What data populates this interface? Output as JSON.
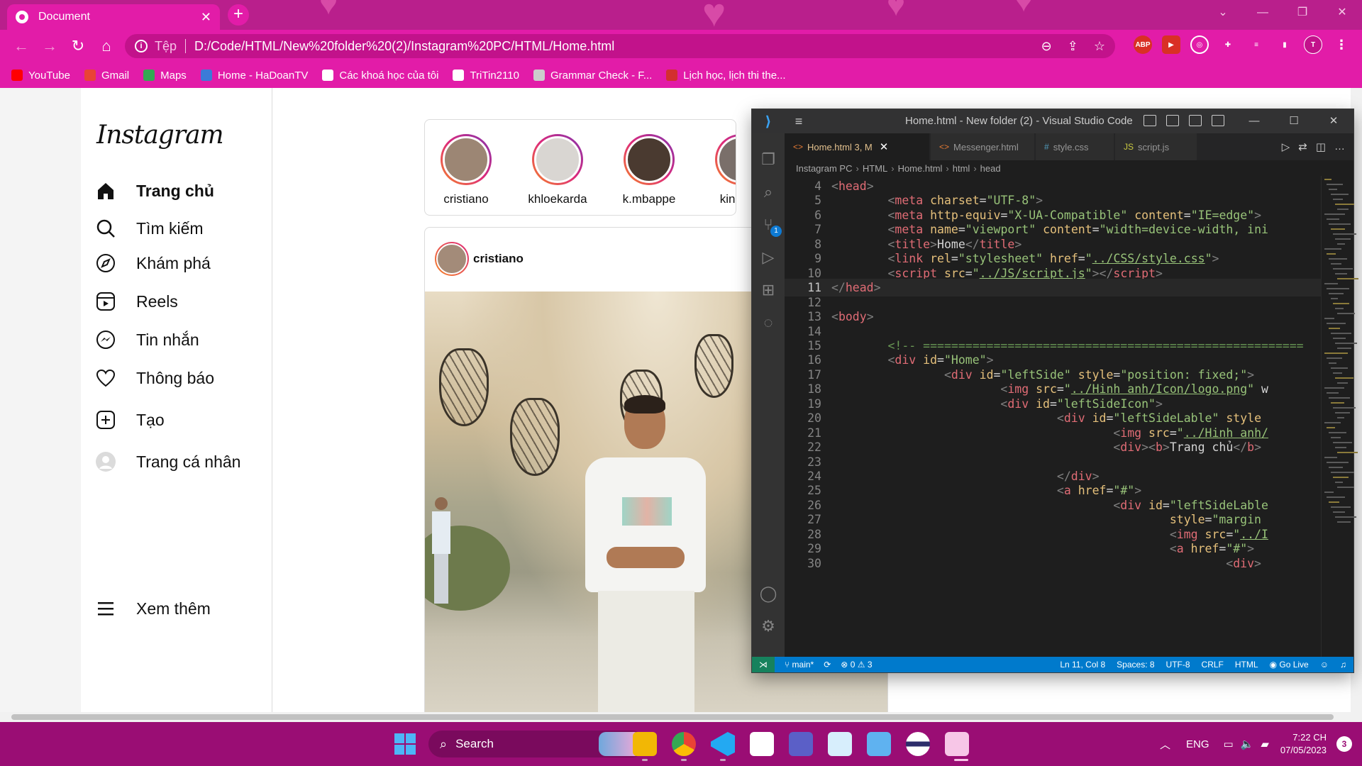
{
  "browser": {
    "tab_title": "Document",
    "tab_close": "✕",
    "new_tab": "+",
    "scheme_label": "Tệp",
    "url": "D:/Code/HTML/New%20folder%20(2)/Instagram%20PC/HTML/Home.html",
    "extensions": [
      "ABP",
      "▶",
      "◎",
      "✚",
      "≡",
      "▮",
      "T"
    ],
    "bookmarks": [
      {
        "label": "YouTube",
        "color": "#ff0000"
      },
      {
        "label": "Gmail",
        "color": "#ea4335"
      },
      {
        "label": "Maps",
        "color": "#34a853"
      },
      {
        "label": "Home - HaDoanTV",
        "color": "#3b7bd8"
      },
      {
        "label": "Các khoá học của tôi",
        "color": "#ffffff"
      },
      {
        "label": "TriTin2110",
        "color": "#ffffff"
      },
      {
        "label": "Grammar Check - F...",
        "color": "#cccccc"
      },
      {
        "label": "Lịch học, lịch thi the...",
        "color": "#d32f2f"
      }
    ]
  },
  "instagram": {
    "logo": "Instagram",
    "nav": [
      {
        "label": "Trang chủ",
        "icon": "home-icon",
        "bold": true
      },
      {
        "label": "Tìm kiếm",
        "icon": "search-icon"
      },
      {
        "label": "Khám phá",
        "icon": "compass-icon"
      },
      {
        "label": "Reels",
        "icon": "reels-icon"
      },
      {
        "label": "Tin nhắn",
        "icon": "messenger-icon"
      },
      {
        "label": "Thông báo",
        "icon": "heart-icon"
      },
      {
        "label": "Tạo",
        "icon": "create-icon"
      },
      {
        "label": "Trang cá nhân",
        "icon": "profile-icon"
      }
    ],
    "more": "Xem thêm",
    "stories": [
      {
        "name": "cristiano",
        "color": "#9c8674"
      },
      {
        "name": "khloekarda",
        "color": "#d9d6d2"
      },
      {
        "name": "k.mbappe",
        "color": "#4a3a30"
      },
      {
        "name": "kingjam",
        "color": "#7a6f6a"
      }
    ],
    "post": {
      "username": "cristiano"
    }
  },
  "vscode": {
    "title": "Home.html - New folder (2) - Visual Studio Code",
    "tabs": [
      {
        "label": "Home.html 3, M",
        "icon": "<>",
        "active": true
      },
      {
        "label": "Messenger.html",
        "icon": "<>"
      },
      {
        "label": "style.css",
        "icon": "#"
      },
      {
        "label": "script.js",
        "icon": "JS"
      }
    ],
    "breadcrumb": [
      "Instagram PC",
      "HTML",
      "Home.html",
      "html",
      "head"
    ],
    "scm_badge": "1",
    "code": [
      {
        "n": "4",
        "t": [
          [
            "br",
            "<"
          ],
          [
            "tag",
            "head"
          ],
          [
            "br",
            ">"
          ]
        ]
      },
      {
        "n": "5",
        "t": [
          [
            "txt",
            "        "
          ],
          [
            "br",
            "<"
          ],
          [
            "tag",
            "meta"
          ],
          [
            "txt",
            " "
          ],
          [
            "attr",
            "charset"
          ],
          [
            "txt",
            "="
          ],
          [
            "str",
            "\"UTF-8\""
          ],
          [
            "br",
            ">"
          ]
        ]
      },
      {
        "n": "6",
        "t": [
          [
            "txt",
            "        "
          ],
          [
            "br",
            "<"
          ],
          [
            "tag",
            "meta"
          ],
          [
            "txt",
            " "
          ],
          [
            "attr",
            "http-equiv"
          ],
          [
            "txt",
            "="
          ],
          [
            "str",
            "\"X-UA-Compatible\""
          ],
          [
            "txt",
            " "
          ],
          [
            "attr",
            "content"
          ],
          [
            "txt",
            "="
          ],
          [
            "str",
            "\"IE=edge\""
          ],
          [
            "br",
            ">"
          ]
        ]
      },
      {
        "n": "7",
        "t": [
          [
            "txt",
            "        "
          ],
          [
            "br",
            "<"
          ],
          [
            "tag",
            "meta"
          ],
          [
            "txt",
            " "
          ],
          [
            "attr",
            "name"
          ],
          [
            "txt",
            "="
          ],
          [
            "str",
            "\"viewport\""
          ],
          [
            "txt",
            " "
          ],
          [
            "attr",
            "content"
          ],
          [
            "txt",
            "="
          ],
          [
            "str",
            "\"width=device-width, ini"
          ]
        ]
      },
      {
        "n": "8",
        "t": [
          [
            "txt",
            "        "
          ],
          [
            "br",
            "<"
          ],
          [
            "tag",
            "title"
          ],
          [
            "br",
            ">"
          ],
          [
            "txt",
            "Home"
          ],
          [
            "br",
            "</"
          ],
          [
            "tag",
            "title"
          ],
          [
            "br",
            ">"
          ]
        ]
      },
      {
        "n": "9",
        "t": [
          [
            "txt",
            "        "
          ],
          [
            "br",
            "<"
          ],
          [
            "tag",
            "link"
          ],
          [
            "txt",
            " "
          ],
          [
            "attr",
            "rel"
          ],
          [
            "txt",
            "="
          ],
          [
            "str",
            "\"stylesheet\""
          ],
          [
            "txt",
            " "
          ],
          [
            "attr",
            "href"
          ],
          [
            "txt",
            "="
          ],
          [
            "str",
            "\""
          ],
          [
            "link",
            "../CSS/style.css"
          ],
          [
            "str",
            "\""
          ],
          [
            "br",
            ">"
          ]
        ]
      },
      {
        "n": "10",
        "t": [
          [
            "txt",
            "        "
          ],
          [
            "br",
            "<"
          ],
          [
            "tag",
            "script"
          ],
          [
            "txt",
            " "
          ],
          [
            "attr",
            "src"
          ],
          [
            "txt",
            "="
          ],
          [
            "str",
            "\""
          ],
          [
            "link",
            "../JS/script.js"
          ],
          [
            "str",
            "\""
          ],
          [
            "br",
            "></"
          ],
          [
            "tag",
            "script"
          ],
          [
            "br",
            ">"
          ]
        ]
      },
      {
        "n": "11",
        "cur": true,
        "t": [
          [
            "br",
            "</"
          ],
          [
            "tag",
            "head"
          ],
          [
            "br",
            ">"
          ]
        ]
      },
      {
        "n": "12",
        "t": []
      },
      {
        "n": "13",
        "t": [
          [
            "br",
            "<"
          ],
          [
            "tag",
            "body"
          ],
          [
            "br",
            ">"
          ]
        ]
      },
      {
        "n": "14",
        "t": []
      },
      {
        "n": "15",
        "t": [
          [
            "txt",
            "        "
          ],
          [
            "com",
            "<!-- ======================================================"
          ]
        ]
      },
      {
        "n": "16",
        "t": [
          [
            "txt",
            "        "
          ],
          [
            "br",
            "<"
          ],
          [
            "tag",
            "div"
          ],
          [
            "txt",
            " "
          ],
          [
            "attr",
            "id"
          ],
          [
            "txt",
            "="
          ],
          [
            "str",
            "\"Home\""
          ],
          [
            "br",
            ">"
          ]
        ]
      },
      {
        "n": "17",
        "t": [
          [
            "txt",
            "                "
          ],
          [
            "br",
            "<"
          ],
          [
            "tag",
            "div"
          ],
          [
            "txt",
            " "
          ],
          [
            "attr",
            "id"
          ],
          [
            "txt",
            "="
          ],
          [
            "str",
            "\"leftSide\""
          ],
          [
            "txt",
            " "
          ],
          [
            "attr",
            "style"
          ],
          [
            "txt",
            "="
          ],
          [
            "str",
            "\"position: fixed;\""
          ],
          [
            "br",
            ">"
          ]
        ]
      },
      {
        "n": "18",
        "t": [
          [
            "txt",
            "                        "
          ],
          [
            "br",
            "<"
          ],
          [
            "tag",
            "img"
          ],
          [
            "txt",
            " "
          ],
          [
            "attr",
            "src"
          ],
          [
            "txt",
            "="
          ],
          [
            "str",
            "\""
          ],
          [
            "link",
            "../Hinh anh/Icon/logo.png"
          ],
          [
            "str",
            "\""
          ],
          [
            "txt",
            " w"
          ]
        ]
      },
      {
        "n": "19",
        "t": [
          [
            "txt",
            "                        "
          ],
          [
            "br",
            "<"
          ],
          [
            "tag",
            "div"
          ],
          [
            "txt",
            " "
          ],
          [
            "attr",
            "id"
          ],
          [
            "txt",
            "="
          ],
          [
            "str",
            "\"leftSideIcon\""
          ],
          [
            "br",
            ">"
          ]
        ]
      },
      {
        "n": "20",
        "t": [
          [
            "txt",
            "                                "
          ],
          [
            "br",
            "<"
          ],
          [
            "tag",
            "div"
          ],
          [
            "txt",
            " "
          ],
          [
            "attr",
            "id"
          ],
          [
            "txt",
            "="
          ],
          [
            "str",
            "\"leftSideLable\""
          ],
          [
            "txt",
            " "
          ],
          [
            "attr",
            "style"
          ]
        ]
      },
      {
        "n": "21",
        "t": [
          [
            "txt",
            "                                        "
          ],
          [
            "br",
            "<"
          ],
          [
            "tag",
            "img"
          ],
          [
            "txt",
            " "
          ],
          [
            "attr",
            "src"
          ],
          [
            "txt",
            "="
          ],
          [
            "str",
            "\""
          ],
          [
            "link",
            "../Hinh anh/"
          ]
        ]
      },
      {
        "n": "22",
        "t": [
          [
            "txt",
            "                                        "
          ],
          [
            "br",
            "<"
          ],
          [
            "tag",
            "div"
          ],
          [
            "br",
            "><"
          ],
          [
            "tag",
            "b"
          ],
          [
            "br",
            ">"
          ],
          [
            "txt",
            "Trang chủ"
          ],
          [
            "br",
            "</"
          ],
          [
            "tag",
            "b"
          ],
          [
            "br",
            ">"
          ]
        ]
      },
      {
        "n": "23",
        "t": []
      },
      {
        "n": "24",
        "t": [
          [
            "txt",
            "                                "
          ],
          [
            "br",
            "</"
          ],
          [
            "tag",
            "div"
          ],
          [
            "br",
            ">"
          ]
        ]
      },
      {
        "n": "25",
        "t": [
          [
            "txt",
            "                                "
          ],
          [
            "br",
            "<"
          ],
          [
            "tag",
            "a"
          ],
          [
            "txt",
            " "
          ],
          [
            "attr",
            "href"
          ],
          [
            "txt",
            "="
          ],
          [
            "str",
            "\"#\""
          ],
          [
            "br",
            ">"
          ]
        ]
      },
      {
        "n": "26",
        "t": [
          [
            "txt",
            "                                        "
          ],
          [
            "br",
            "<"
          ],
          [
            "tag",
            "div"
          ],
          [
            "txt",
            " "
          ],
          [
            "attr",
            "id"
          ],
          [
            "txt",
            "="
          ],
          [
            "str",
            "\"leftSideLable"
          ]
        ]
      },
      {
        "n": "27",
        "t": [
          [
            "txt",
            "                                                "
          ],
          [
            "attr",
            "style"
          ],
          [
            "txt",
            "="
          ],
          [
            "str",
            "\"margin"
          ]
        ]
      },
      {
        "n": "28",
        "t": [
          [
            "txt",
            "                                                "
          ],
          [
            "br",
            "<"
          ],
          [
            "tag",
            "img"
          ],
          [
            "txt",
            " "
          ],
          [
            "attr",
            "src"
          ],
          [
            "txt",
            "="
          ],
          [
            "str",
            "\""
          ],
          [
            "link",
            "../I"
          ]
        ]
      },
      {
        "n": "29",
        "t": [
          [
            "txt",
            "                                                "
          ],
          [
            "br",
            "<"
          ],
          [
            "tag",
            "a"
          ],
          [
            "txt",
            " "
          ],
          [
            "attr",
            "href"
          ],
          [
            "txt",
            "="
          ],
          [
            "str",
            "\"#\""
          ],
          [
            "br",
            ">"
          ]
        ]
      },
      {
        "n": "30",
        "t": [
          [
            "txt",
            "                                                        "
          ],
          [
            "br",
            "<"
          ],
          [
            "tag",
            "div"
          ],
          [
            "br",
            ">"
          ]
        ]
      }
    ],
    "status": {
      "branch": "main*",
      "problems_errors": "0",
      "problems_warnings": "3",
      "position": "Ln 11, Col 8",
      "spaces": "Spaces: 8",
      "encoding": "UTF-8",
      "eol": "CRLF",
      "language": "HTML",
      "live": "Go Live"
    }
  },
  "taskbar": {
    "search_label": "Search",
    "language": "ENG",
    "time": "7:22 CH",
    "date": "07/05/2023",
    "notifications": "3"
  }
}
